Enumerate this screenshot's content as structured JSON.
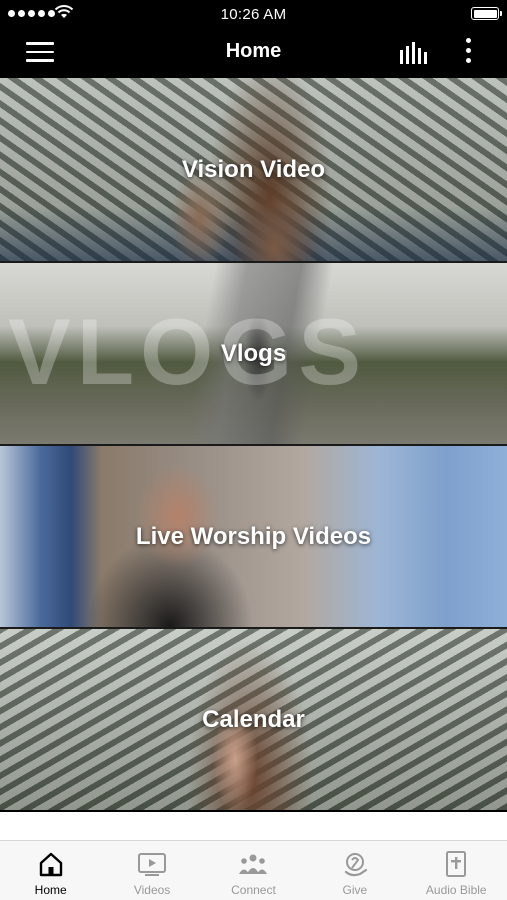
{
  "status_bar": {
    "time": "10:26 AM"
  },
  "header": {
    "title": "Home"
  },
  "tiles": [
    {
      "label": "Vision Video"
    },
    {
      "label": "Vlogs",
      "overlay_text": "VLOGS"
    },
    {
      "label": "Live Worship Videos"
    },
    {
      "label": "Calendar"
    }
  ],
  "tab_bar": {
    "items": [
      {
        "label": "Home",
        "icon": "home-icon",
        "active": true
      },
      {
        "label": "Videos",
        "icon": "video-icon",
        "active": false
      },
      {
        "label": "Connect",
        "icon": "people-icon",
        "active": false
      },
      {
        "label": "Give",
        "icon": "give-icon",
        "active": false
      },
      {
        "label": "Audio Bible",
        "icon": "bible-icon",
        "active": false
      }
    ]
  },
  "colors": {
    "bar_bg": "#000000",
    "tab_active": "#000000",
    "tab_inactive": "#999999"
  }
}
